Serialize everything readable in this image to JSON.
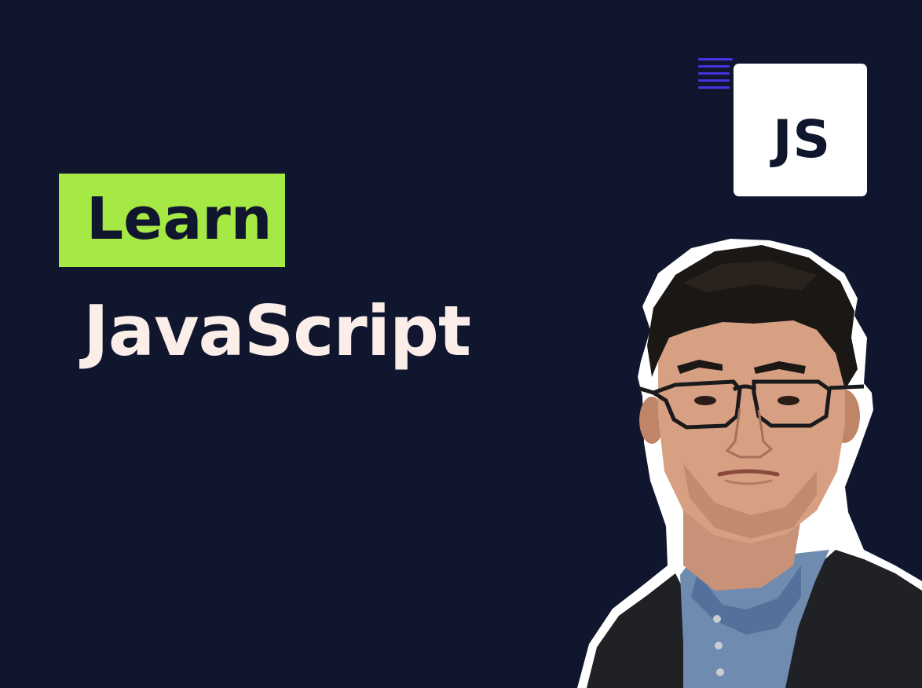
{
  "badge": {
    "label": "Learn"
  },
  "title": "JavaScript",
  "logo": {
    "text": "JS",
    "icon": "javascript-logo-icon"
  },
  "colors": {
    "background": "#11162f",
    "badge": "#a6e844",
    "title": "#fbeee8",
    "accent_lines": "#4a32e0",
    "logo_tile": "#ffffff"
  },
  "portrait": {
    "icon": "instructor-portrait"
  }
}
